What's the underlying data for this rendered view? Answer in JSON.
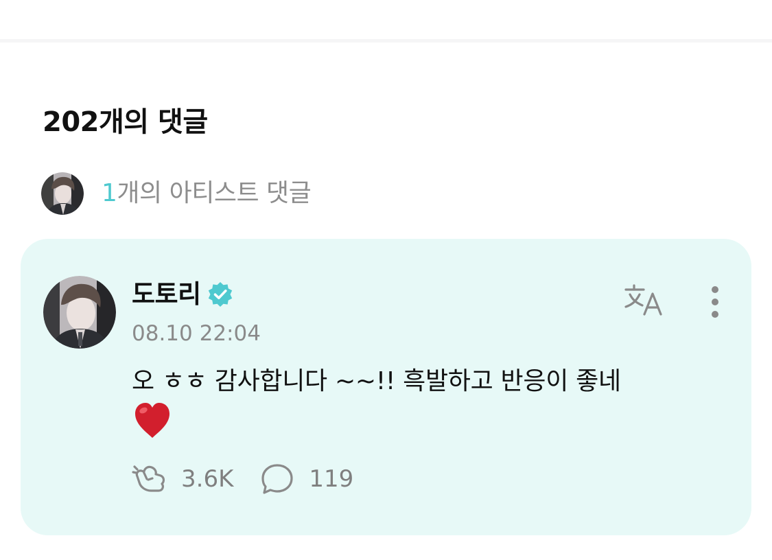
{
  "comments_section": {
    "title": "202개의 댓글",
    "artist_summary": {
      "count": "1",
      "label": "개의 아티스트 댓글"
    }
  },
  "comment": {
    "author": "도토리",
    "verified": true,
    "timestamp": "08.10 22:04",
    "body": "오 ㅎㅎ 감사합니다 ~~!! 흑발하고 반응이 좋네",
    "emoji": "heart-emoji",
    "likes": "3.6K",
    "replies": "119"
  },
  "icons": {
    "verified": "verified-badge-icon",
    "translate": "translate-icon",
    "more": "more-vertical-icon",
    "like": "cheer-icon",
    "reply": "comment-bubble-icon"
  },
  "colors": {
    "accent": "#4ec9cf",
    "card_background": "#e7f9f7",
    "icon_gray": "#8a8a8a",
    "heart": "#d21f2d"
  }
}
